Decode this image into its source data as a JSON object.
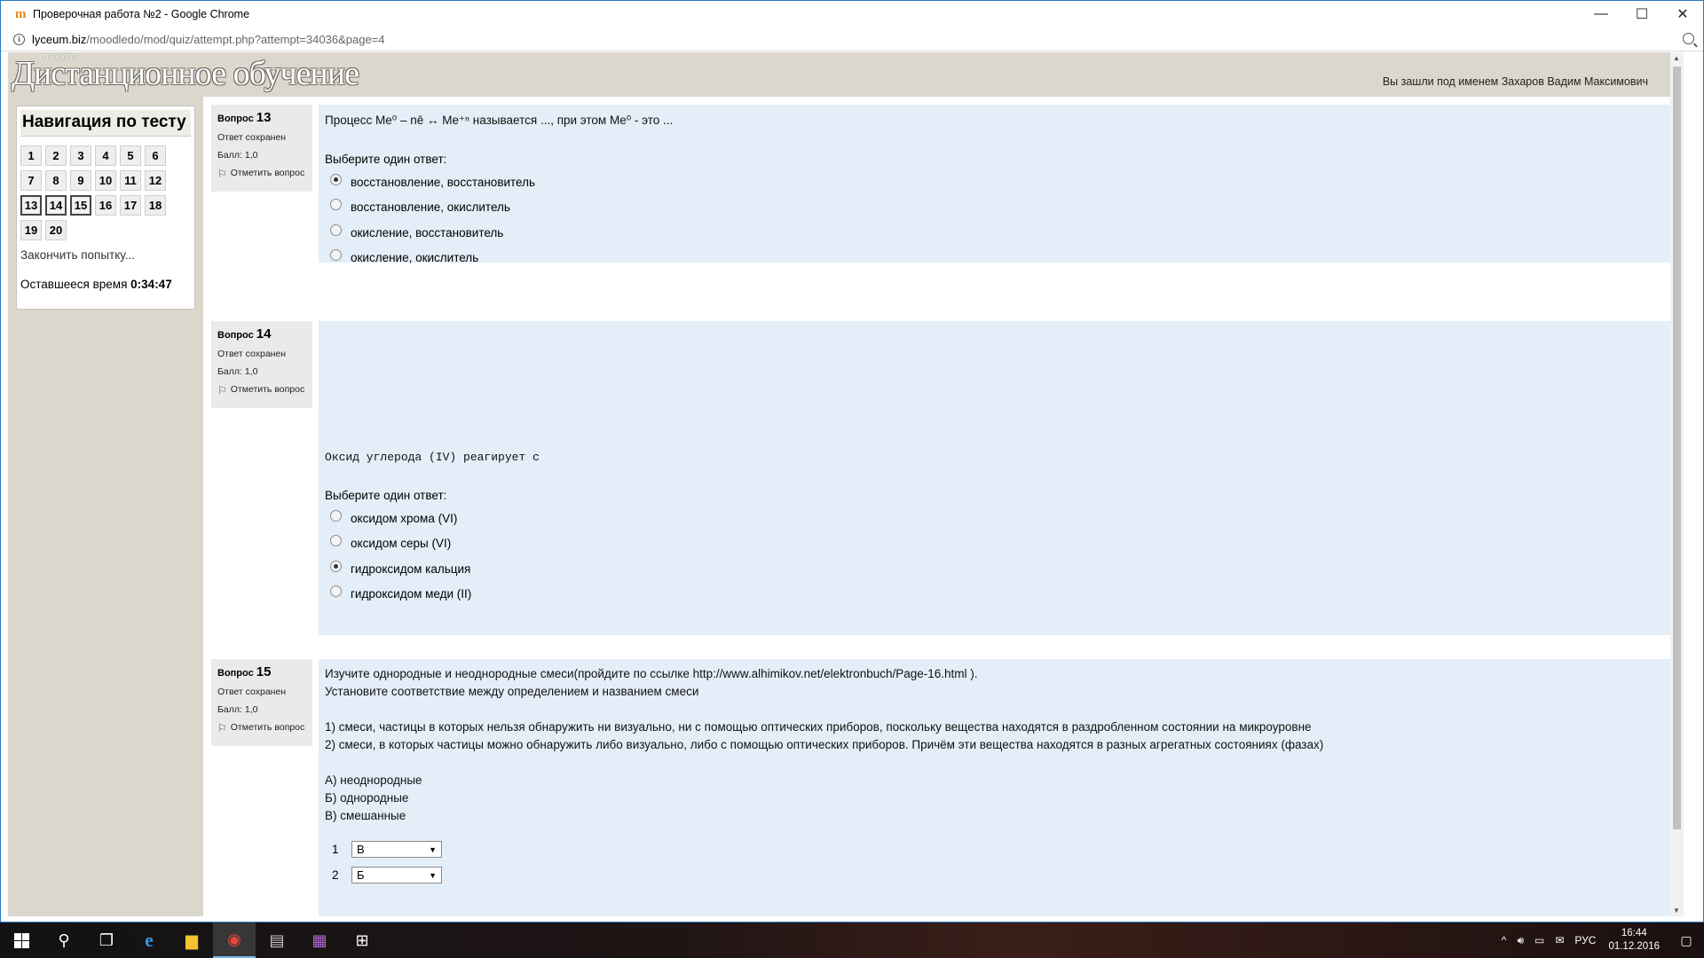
{
  "window": {
    "title": "Проверочная работа №2 - Google Chrome",
    "app_icon": "m",
    "controls": {
      "minimize": "—",
      "maximize": "☐",
      "close": "✕"
    }
  },
  "address": {
    "host": "lyceum.biz",
    "path": "/moodledo/mod/quiz/attempt.php?attempt=34036&page=4"
  },
  "header": {
    "logo_text": "Дистанционное обучение",
    "logo_sub": "moodle",
    "login_info": "Вы зашли под именем Захаров Вадим Максимович"
  },
  "nav": {
    "title": "Навигация по тесту",
    "buttons": [
      "1",
      "2",
      "3",
      "4",
      "5",
      "6",
      "7",
      "8",
      "9",
      "10",
      "11",
      "12",
      "13",
      "14",
      "15",
      "16",
      "17",
      "18",
      "19",
      "20"
    ],
    "current": [
      "13",
      "14",
      "15"
    ],
    "finish": "Закончить попытку...",
    "time_label": "Оставшееся время",
    "time_value": "0:34:47"
  },
  "questions": [
    {
      "label": "Вопрос",
      "number": "13",
      "state": "Ответ сохранен",
      "grade": "Балл: 1,0",
      "flag": "Отметить вопрос",
      "text": "Процесс Me⁰ – nē ↔ Me⁺ⁿ называется ..., при этом Me⁰ - это ...",
      "prompt": "Выберите один ответ:",
      "options": [
        {
          "label": "восстановление, восстановитель",
          "checked": true
        },
        {
          "label": "восстановление, окислитель",
          "checked": false
        },
        {
          "label": "окисление, восстановитель",
          "checked": false
        },
        {
          "label": "окисление, окислитель",
          "checked": false
        }
      ]
    },
    {
      "label": "Вопрос",
      "number": "14",
      "state": "Ответ сохранен",
      "grade": "Балл: 1,0",
      "flag": "Отметить вопрос",
      "text": "Оксид углерода (IV) реагирует с",
      "prompt": "Выберите один ответ:",
      "options": [
        {
          "label": "оксидом хрома (VI)",
          "checked": false
        },
        {
          "label": "оксидом серы (VI)",
          "checked": false
        },
        {
          "label": "гидроксидом кальция",
          "checked": true
        },
        {
          "label": "гидроксидом меди (II)",
          "checked": false
        }
      ]
    },
    {
      "label": "Вопрос",
      "number": "15",
      "state": "Ответ сохранен",
      "grade": "Балл: 1,0",
      "flag": "Отметить вопрос",
      "intro1": "Изучите однородные и неоднородные смеси(пройдите по ссылке http://www.alhimikov.net/elektronbuch/Page-16.html ).",
      "intro2": "Установите соответствие между определением и названием смеси",
      "def1": "1) смеси, частицы в которых нельзя обнаружить ни визуально, ни с помощью оптических приборов, поскольку вещества находятся в раздробленном состоянии на микроуровне",
      "def2": "2) смеси, в которых частицы можно обнаружить либо визуально, либо с помощью оптических приборов. Причём эти вещества находятся в разных агрегатных состояниях (фазах)",
      "name_a": "А) неоднородные",
      "name_b": "Б) однородные",
      "name_c": "В) смешанные",
      "matches": [
        {
          "num": "1",
          "value": "В"
        },
        {
          "num": "2",
          "value": "Б"
        }
      ]
    }
  ],
  "taskbar": {
    "lang": "РУС",
    "time": "16:44",
    "date": "01.12.2016"
  }
}
